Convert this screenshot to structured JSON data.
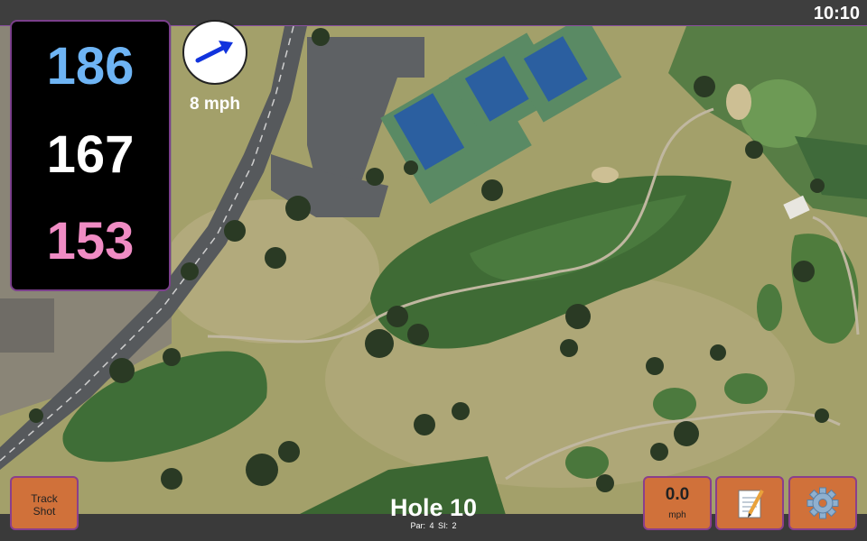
{
  "status_bar": {
    "time": "10:10"
  },
  "distances": {
    "back": "186",
    "middle": "167",
    "front": "153"
  },
  "wind": {
    "speed": "8 mph",
    "direction": "arrow pointing up-right"
  },
  "buttons": {
    "track_shot_line1": "Track",
    "track_shot_line2": "Shot",
    "speed_value": "0.0",
    "speed_unit": "mph"
  },
  "hole": {
    "title": "Hole 10",
    "par": "Par: 4",
    "si": "SI: 2"
  },
  "icons": [
    "wind-arrow-icon",
    "scorecard-icon",
    "gear-icon"
  ],
  "colors": {
    "back": "#6eb4f4",
    "middle": "#ffffff",
    "front": "#f08cc4",
    "button": "#d0713a",
    "accent": "#8a3f8c"
  }
}
